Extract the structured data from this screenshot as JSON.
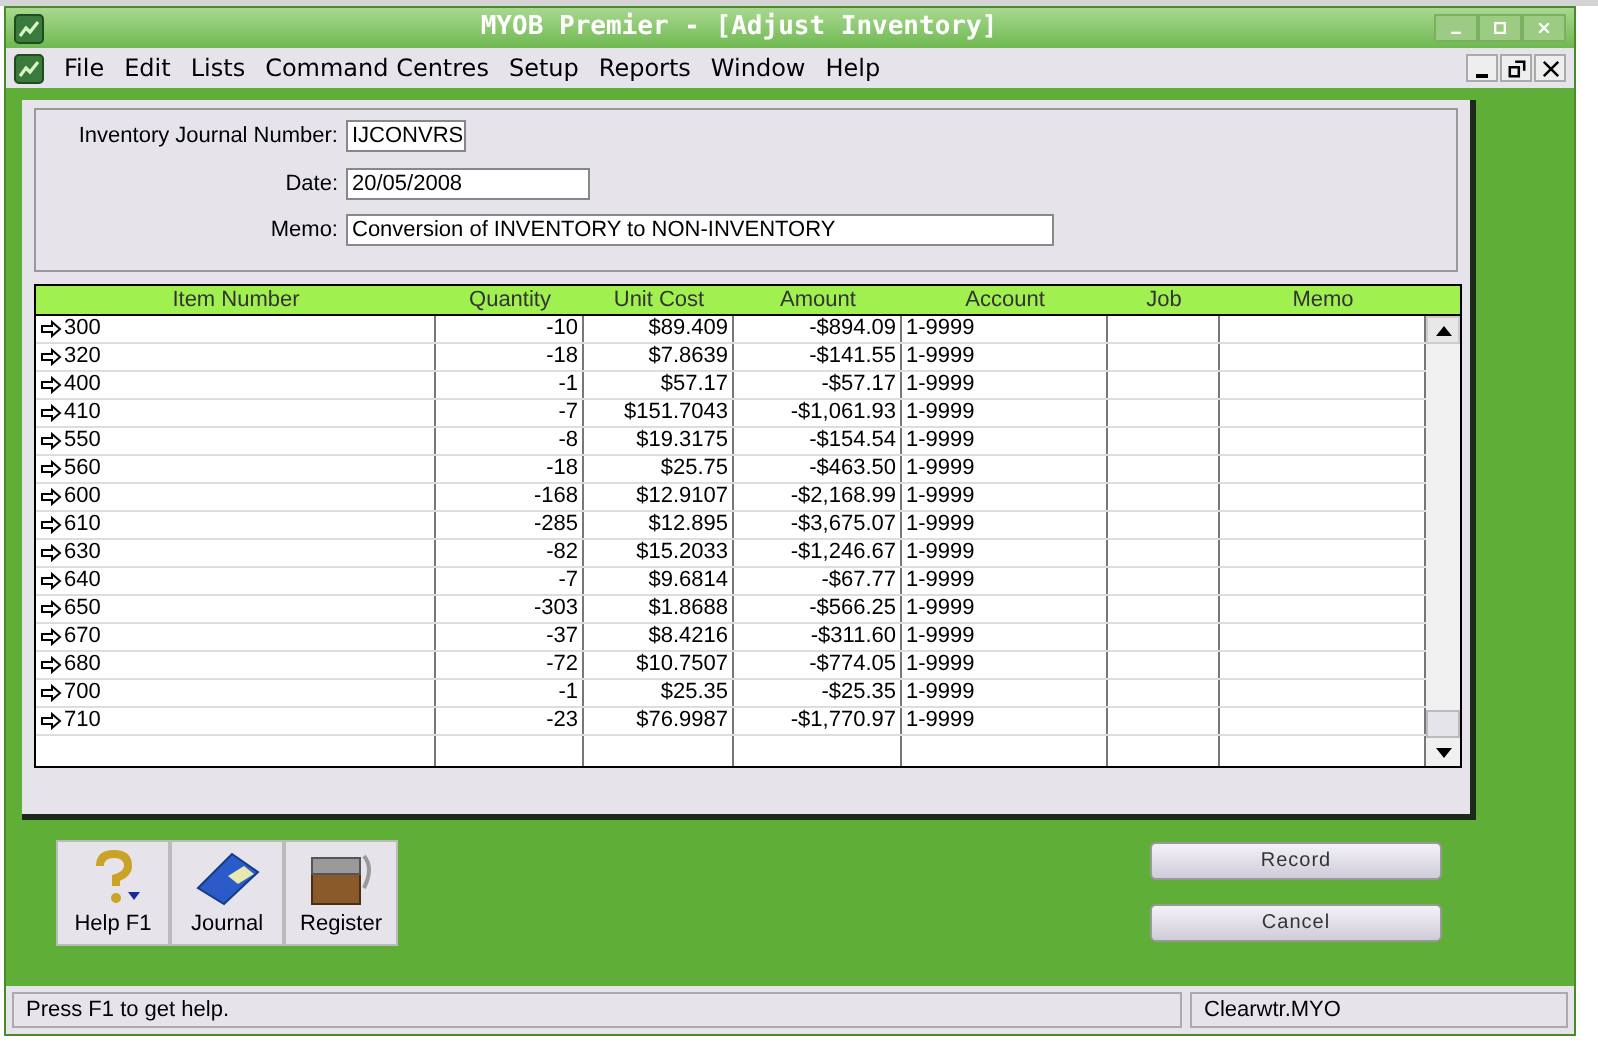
{
  "window": {
    "title": "MYOB Premier - [Adjust Inventory]"
  },
  "menu": [
    "File",
    "Edit",
    "Lists",
    "Command Centres",
    "Setup",
    "Reports",
    "Window",
    "Help"
  ],
  "form": [
    {
      "label": "Inventory Journal Number:",
      "value": "IJCONVRS",
      "kind": "short"
    },
    {
      "label": "Date:",
      "value": "20/05/2008",
      "kind": "medium"
    },
    {
      "label": "Memo:",
      "value": "Conversion of INVENTORY to NON-INVENTORY",
      "kind": "long"
    }
  ],
  "table": {
    "columns": [
      "Item Number",
      "Quantity",
      "Unit Cost",
      "Amount",
      "Account",
      "Job",
      "Memo"
    ],
    "rows": [
      [
        "300",
        "-10",
        "$89.409",
        "-$894.09",
        "1-9999"
      ],
      [
        "320",
        "-18",
        "$7.8639",
        "-$141.55",
        "1-9999"
      ],
      [
        "400",
        "-1",
        "$57.17",
        "-$57.17",
        "1-9999"
      ],
      [
        "410",
        "-7",
        "$151.7043",
        "-$1,061.93",
        "1-9999"
      ],
      [
        "550",
        "-8",
        "$19.3175",
        "-$154.54",
        "1-9999"
      ],
      [
        "560",
        "-18",
        "$25.75",
        "-$463.50",
        "1-9999"
      ],
      [
        "600",
        "-168",
        "$12.9107",
        "-$2,168.99",
        "1-9999"
      ],
      [
        "610",
        "-285",
        "$12.895",
        "-$3,675.07",
        "1-9999"
      ],
      [
        "630",
        "-82",
        "$15.2033",
        "-$1,246.67",
        "1-9999"
      ],
      [
        "640",
        "-7",
        "$9.6814",
        "-$67.77",
        "1-9999"
      ],
      [
        "650",
        "-303",
        "$1.8688",
        "-$566.25",
        "1-9999"
      ],
      [
        "670",
        "-37",
        "$8.4216",
        "-$311.60",
        "1-9999"
      ],
      [
        "680",
        "-72",
        "$10.7507",
        "-$774.05",
        "1-9999"
      ],
      [
        "700",
        "-1",
        "$25.35",
        "-$25.35",
        "1-9999"
      ],
      [
        "710",
        "-23",
        "$76.9987",
        "-$1,770.97",
        "1-9999"
      ]
    ]
  },
  "toolbar": [
    {
      "label": "Help F1",
      "kind": "help"
    },
    {
      "label": "Journal",
      "kind": "journal"
    },
    {
      "label": "Register",
      "kind": "register"
    }
  ],
  "buttons": [
    "Record",
    "Cancel"
  ],
  "status_bar": [
    "Press F1 to get help.",
    "Clearwtr.MYO"
  ]
}
